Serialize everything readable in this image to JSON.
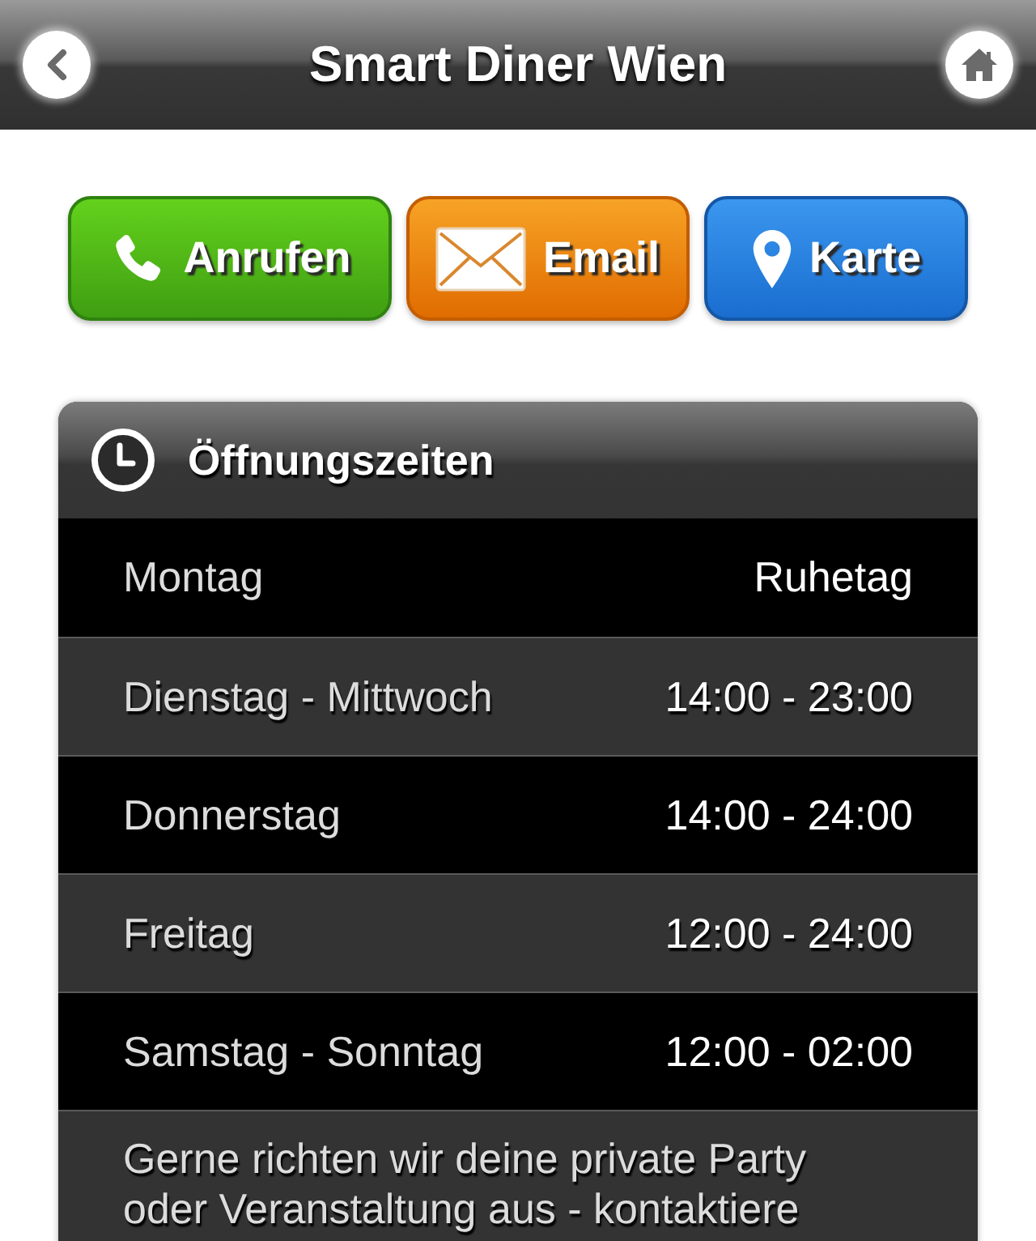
{
  "header": {
    "title": "Smart Diner Wien"
  },
  "actions": [
    {
      "kind": "call",
      "label": "Anrufen"
    },
    {
      "kind": "email",
      "label": "Email"
    },
    {
      "kind": "map",
      "label": "Karte"
    }
  ],
  "opening_hours": {
    "title": "Öffnungszeiten",
    "rows": [
      {
        "day": "Montag",
        "time": "Ruhetag"
      },
      {
        "day": "Dienstag - Mittwoch",
        "time": "14:00 - 23:00"
      },
      {
        "day": "Donnerstag",
        "time": "14:00 - 24:00"
      },
      {
        "day": "Freitag",
        "time": "12:00 - 24:00"
      },
      {
        "day": "Samstag - Sonntag",
        "time": "12:00 - 02:00"
      }
    ],
    "note": "Gerne richten wir deine private Party oder Veranstaltung aus - kontaktiere"
  }
}
